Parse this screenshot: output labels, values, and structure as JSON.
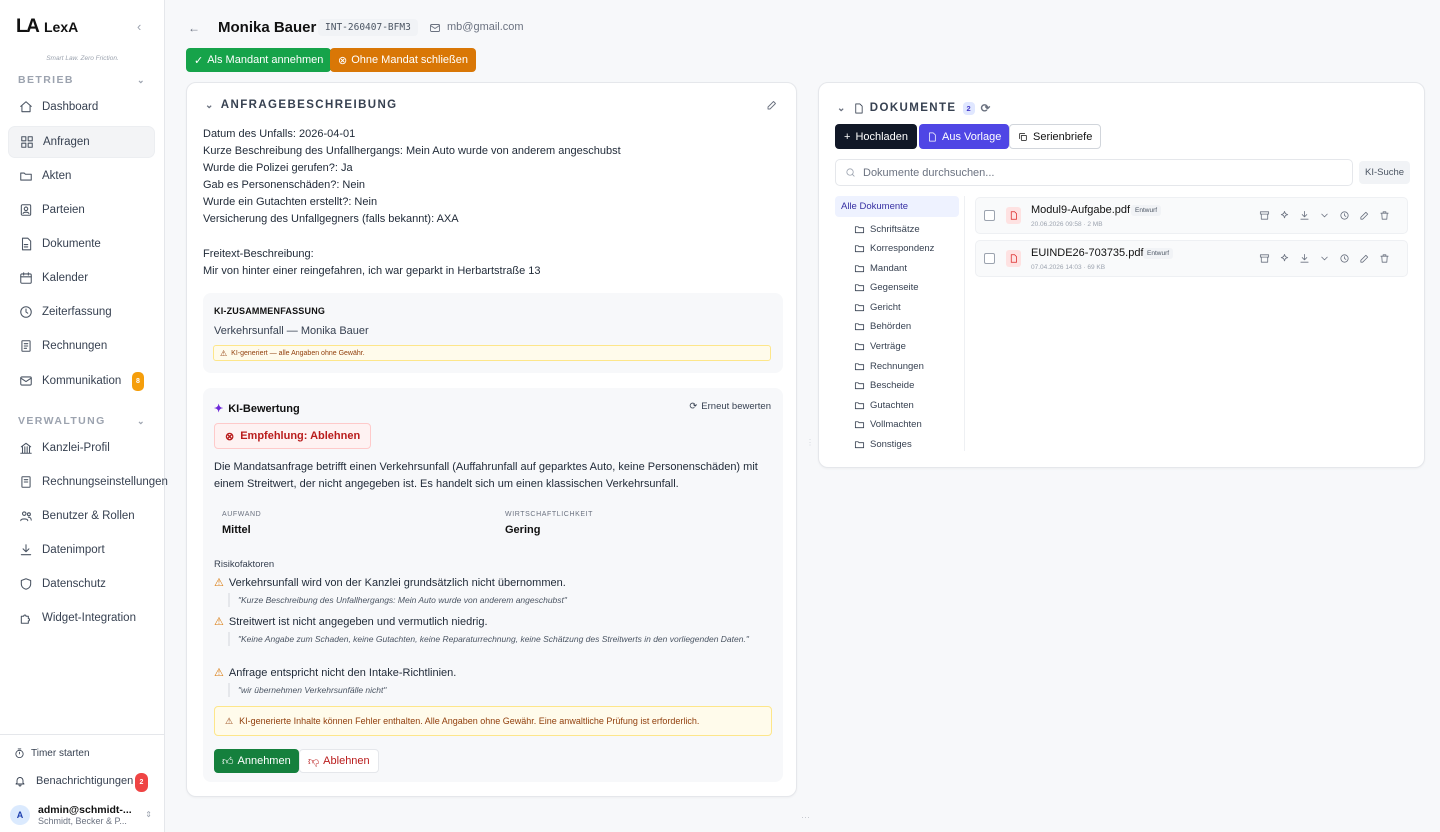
{
  "sidebar": {
    "brand": {
      "logo": "LA",
      "name": "LexA",
      "tagline": "Smart Law. Zero Friction."
    },
    "collapse_glyph": "‹",
    "sections": [
      {
        "label": "BETRIEB",
        "items": [
          {
            "label": "Dashboard",
            "icon": "home-icon"
          },
          {
            "label": "Anfragen",
            "icon": "grid-icon",
            "active": true
          },
          {
            "label": "Akten",
            "icon": "folder-open-icon"
          },
          {
            "label": "Parteien",
            "icon": "id-card-icon"
          },
          {
            "label": "Dokumente",
            "icon": "file-icon"
          },
          {
            "label": "Kalender",
            "icon": "calendar-icon"
          },
          {
            "label": "Zeiterfassung",
            "icon": "clock-icon"
          },
          {
            "label": "Rechnungen",
            "icon": "receipt-icon"
          },
          {
            "label": "Kommunikation",
            "icon": "mail-icon",
            "badge": "8"
          }
        ]
      },
      {
        "label": "VERWALTUNG",
        "items": [
          {
            "label": "Kanzlei-Profil",
            "icon": "building-icon"
          },
          {
            "label": "Rechnungseinstellungen",
            "icon": "receipt-settings-icon"
          },
          {
            "label": "Benutzer & Rollen",
            "icon": "users-icon"
          },
          {
            "label": "Datenimport",
            "icon": "download-icon"
          },
          {
            "label": "Datenschutz",
            "icon": "shield-icon"
          },
          {
            "label": "Widget-Integration",
            "icon": "puzzle-icon"
          }
        ]
      }
    ],
    "timer_label": "Timer starten",
    "notifications": {
      "label": "Benachrichtigungen",
      "count": "2"
    },
    "user": {
      "initial": "A",
      "email": "admin@schmidt-...",
      "org": "Schmidt, Becker & P..."
    }
  },
  "header": {
    "back_glyph": "←",
    "client_name": "Monika Bauer",
    "inquiry_id": "INT-260407-BFM3",
    "email": "mb@gmail.com",
    "accept_button": "Als Mandant annehmen",
    "close_button": "Ohne Mandat schließen"
  },
  "description": {
    "title": "ANFRAGEBESCHREIBUNG",
    "lines": [
      "Datum des Unfalls: 2026-04-01",
      "Kurze Beschreibung des Unfallhergangs: Mein Auto wurde von anderem angeschubst",
      "Wurde die Polizei gerufen?: Ja",
      "Gab es Personenschäden?: Nein",
      "Wurde ein Gutachten erstellt?: Nein",
      "Versicherung des Unfallgegners (falls bekannt): AXA",
      "",
      "Freitext-Beschreibung:",
      "Mir von hinter einer reingefahren, ich war geparkt in Herbartstraße 13"
    ],
    "summary": {
      "title": "KI-ZUSAMMENFASSUNG",
      "text": "Verkehrsunfall — Monika Bauer",
      "disclaimer": "KI-generiert — alle Angaben ohne Gewähr."
    },
    "evaluation": {
      "title": "KI-Bewertung",
      "reevaluate": "Erneut bewerten",
      "recommendation": "Empfehlung: Ablehnen",
      "text": "Die Mandatsanfrage betrifft einen Verkehrsunfall (Auffahrunfall auf geparktes Auto, keine Personenschäden) mit einem Streitwert, der nicht angegeben ist. Es handelt sich um einen klassischen Verkehrsunfall.",
      "effort_label": "AUFWAND",
      "effort_value": "Mittel",
      "economy_label": "WIRTSCHAFTLICHKEIT",
      "economy_value": "Gering",
      "risk_title": "Risikofaktoren",
      "risks": [
        {
          "title": "Verkehrsunfall wird von der Kanzlei grundsätzlich nicht übernommen.",
          "quote": "\"Kurze Beschreibung des Unfallhergangs: Mein Auto wurde von anderem angeschubst\""
        },
        {
          "title": "Streitwert ist nicht angegeben und vermutlich niedrig.",
          "quote": "\"Keine Angabe zum Schaden, keine Gutachten, keine Reparaturrechnung, keine Schätzung des Streitwerts in den vorliegenden Daten.\""
        },
        {
          "title": "Anfrage entspricht nicht den Intake-Richtlinien.",
          "quote": "\"wir übernehmen Verkehrsunfälle nicht\""
        }
      ],
      "warning": "KI-generierte Inhalte können Fehler enthalten. Alle Angaben ohne Gewähr. Eine anwaltliche Prüfung ist erforderlich.",
      "accept": "Annehmen",
      "reject": "Ablehnen"
    }
  },
  "documents": {
    "title": "DOKUMENTE",
    "count": "2",
    "upload": "Hochladen",
    "template": "Aus Vorlage",
    "serial": "Serienbriefe",
    "search_placeholder": "Dokumente durchsuchen...",
    "ki_search": "KI-Suche",
    "folder_all": "Alle Dokumente",
    "folders": [
      "Schriftsätze",
      "Korrespondenz",
      "Mandant",
      "Gegenseite",
      "Gericht",
      "Behörden",
      "Verträge",
      "Rechnungen",
      "Bescheide",
      "Gutachten",
      "Vollmachten",
      "Sonstiges"
    ],
    "files": [
      {
        "name": "Modul9-Aufgabe.pdf",
        "status": "Entwurf",
        "meta": "20.06.2026 09:58 · 2 MB"
      },
      {
        "name": "EUINDE26-703735.pdf",
        "status": "Entwurf",
        "meta": "07.04.2026 14:03 · 69 KB"
      }
    ]
  },
  "colors": {
    "accept": "#16a34a",
    "close": "#d97706",
    "primary": "#111827",
    "accent": "#4f46e5",
    "danger": "#b91c1c"
  }
}
